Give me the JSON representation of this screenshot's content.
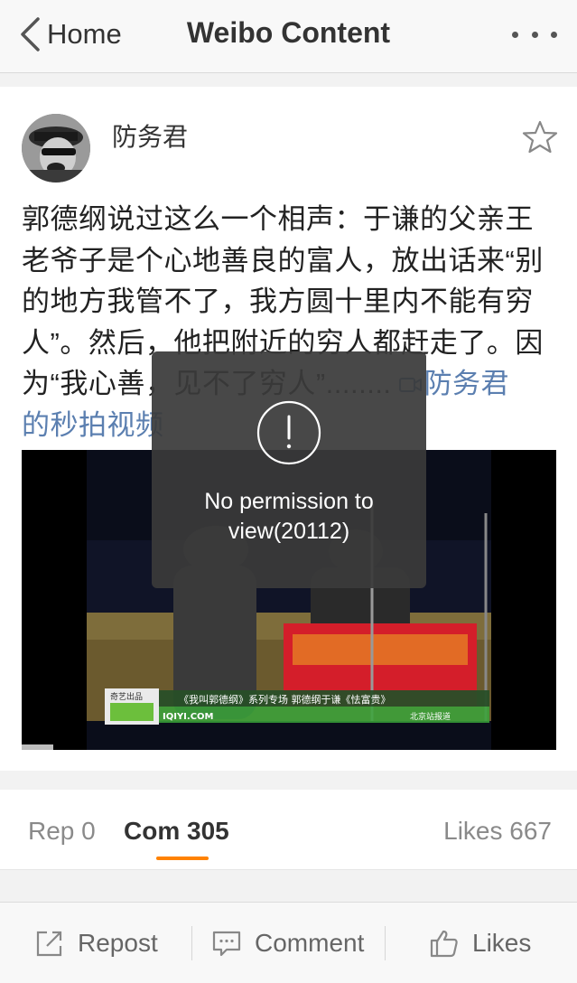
{
  "navbar": {
    "back_label": "Home",
    "title": "Weibo Content"
  },
  "post": {
    "author": "防务君",
    "text_lines": [
      "郭德纲说过这么一个相声：于谦的父亲王",
      "老爷子是个心地善良的富人，放出话来“别",
      "的地方我管不了，我方圆十里内不能有穷",
      "人”。然后，他把附近的穷人都赶走了。因",
      "为“我心善，见不了穷人”........"
    ],
    "link_line_a": "防务君",
    "link_line_b": "的秒拍视频",
    "video": {
      "banner_left": "奇艺出品",
      "banner_url": "IQIYI.COM",
      "banner_text": "《我叫郭德纲》系列专场 郭德纲于谦《怯富贵》",
      "banner_right": "北京站报道"
    }
  },
  "toast": {
    "message": "No permission to view(20112)"
  },
  "tabs": {
    "repost": "Rep 0",
    "comments": "Com 305",
    "likes": "Likes 667"
  },
  "toolbar": {
    "repost": "Repost",
    "comment": "Comment",
    "likes": "Likes"
  },
  "colors": {
    "accent": "#ff8200",
    "link": "#5b7fb0"
  }
}
